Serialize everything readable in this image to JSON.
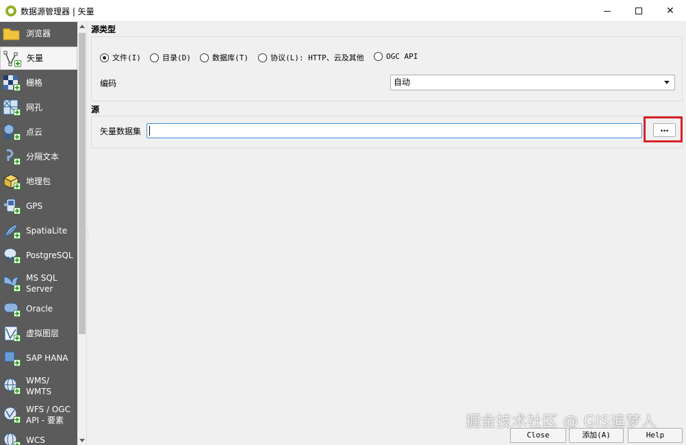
{
  "window": {
    "title": "数据源管理器 | 矢量"
  },
  "sidebar": {
    "items": [
      {
        "label": "浏览器",
        "icon": "folder-icon"
      },
      {
        "label": "矢量",
        "icon": "vector-icon",
        "selected": true
      },
      {
        "label": "栅格",
        "icon": "raster-icon"
      },
      {
        "label": "网孔",
        "icon": "mesh-icon"
      },
      {
        "label": "点云",
        "icon": "point-cloud-icon"
      },
      {
        "label": "分隔文本",
        "icon": "delimited-text-icon"
      },
      {
        "label": "地理包",
        "icon": "geopackage-icon"
      },
      {
        "label": "GPS",
        "icon": "gps-icon"
      },
      {
        "label": "SpatiaLite",
        "icon": "spatialite-icon"
      },
      {
        "label": "PostgreSQL",
        "icon": "postgresql-icon"
      },
      {
        "label": "MS SQL\nServer",
        "icon": "mssql-icon"
      },
      {
        "label": "Oracle",
        "icon": "oracle-icon"
      },
      {
        "label": "虚拟图层",
        "icon": "virtual-layer-icon"
      },
      {
        "label": "SAP HANA",
        "icon": "sap-hana-icon"
      },
      {
        "label": "WMS/\nWMTS",
        "icon": "wms-icon"
      },
      {
        "label": "WFS / OGC\nAPI - 要素",
        "icon": "wfs-icon"
      },
      {
        "label": "WCS",
        "icon": "wcs-icon"
      }
    ]
  },
  "source_type": {
    "title": "源类型",
    "options": [
      {
        "label": "文件(I)",
        "checked": true
      },
      {
        "label": "目录(D)",
        "checked": false
      },
      {
        "label": "数据库(T)",
        "checked": false
      },
      {
        "label": "协议(L): HTTP、云及其他",
        "checked": false
      },
      {
        "label": "OGC API",
        "checked": false
      }
    ],
    "encoding_label": "编码",
    "encoding_value": "自动"
  },
  "source": {
    "title": "源",
    "dataset_label": "矢量数据集",
    "dataset_value": "",
    "browse_label": "…"
  },
  "footer": {
    "close_label": "Close",
    "add_label": "添加(A)",
    "help_label": "Help"
  },
  "watermark": "掘金技术社区 @ GIS追梦人",
  "colors": {
    "sidebar_bg": "#5b5b5b",
    "highlight": "#d82026",
    "focus": "#3c8fd9",
    "add_icon": "#3c9a2f"
  }
}
